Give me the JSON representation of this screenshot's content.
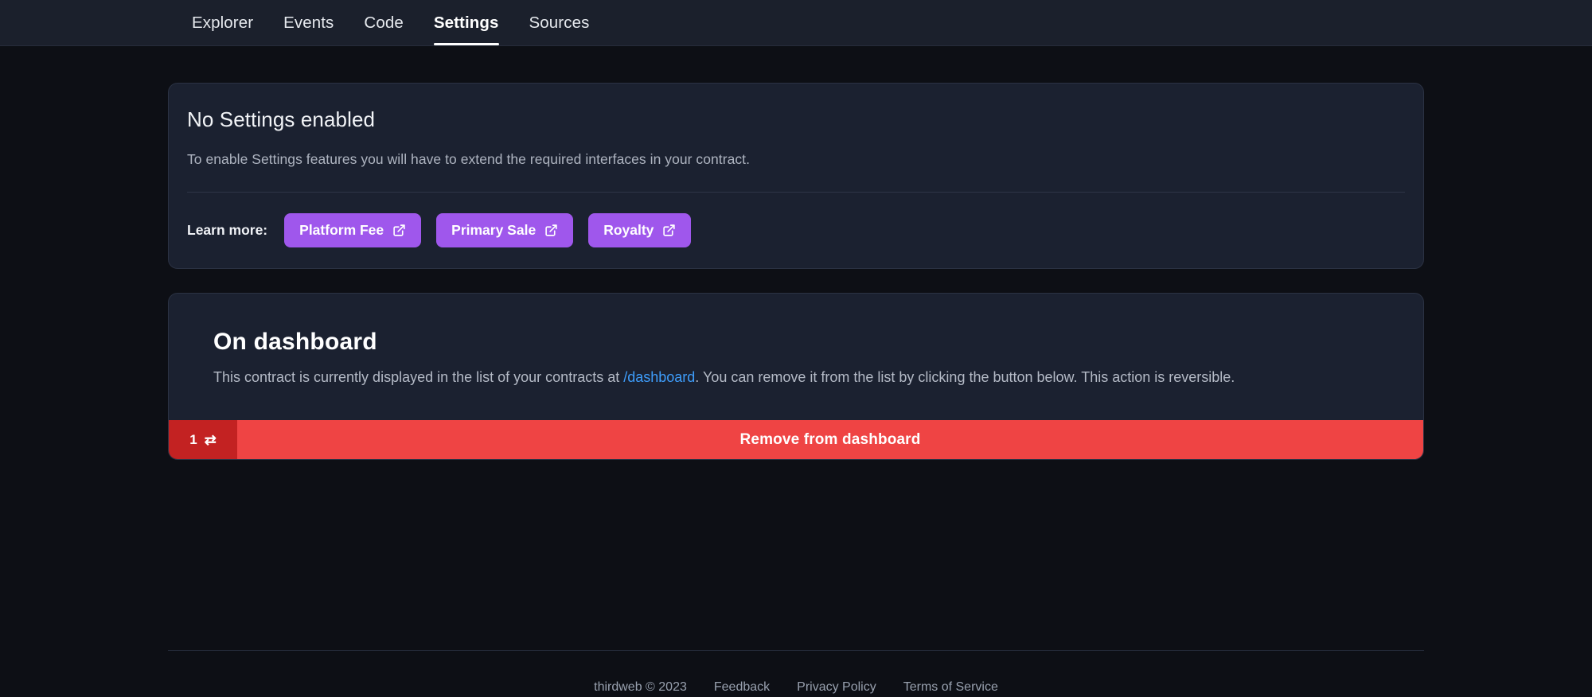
{
  "nav": {
    "items": [
      {
        "label": "Explorer",
        "active": false
      },
      {
        "label": "Events",
        "active": false
      },
      {
        "label": "Code",
        "active": false
      },
      {
        "label": "Settings",
        "active": true
      },
      {
        "label": "Sources",
        "active": false
      }
    ]
  },
  "settings_card": {
    "title": "No Settings enabled",
    "description": "To enable Settings features you will have to extend the required interfaces in your contract.",
    "learn_more_label": "Learn more:",
    "links": [
      {
        "label": "Platform Fee",
        "icon": "external-link-icon"
      },
      {
        "label": "Primary Sale",
        "icon": "external-link-icon"
      },
      {
        "label": "Royalty",
        "icon": "external-link-icon"
      }
    ],
    "accent_color": "#9f57ec"
  },
  "dashboard_card": {
    "title": "On dashboard",
    "desc_part1": "This contract is currently displayed in the list of your contracts at ",
    "desc_link": "/dashboard",
    "desc_part2": ". You can remove it from the list by clicking the button below. This action is reversible.",
    "link_color": "#3e9dfb",
    "chain_badge": {
      "count": "1",
      "icon": "network-swap-icon",
      "color": "#c32222"
    },
    "action_label": "Remove from dashboard",
    "action_color": "#ef4444"
  },
  "footer": {
    "copyright": "thirdweb © 2023",
    "links": [
      {
        "label": "Feedback"
      },
      {
        "label": "Privacy Policy"
      },
      {
        "label": "Terms of Service"
      }
    ]
  }
}
